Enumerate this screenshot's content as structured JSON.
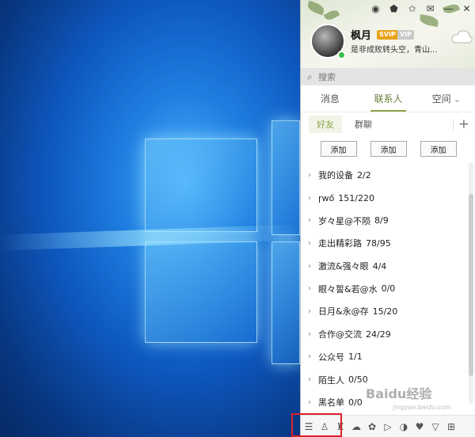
{
  "panel": {
    "profile": {
      "nickname": "枫月",
      "svip_badge": "SVIP",
      "vip_badge": "VIP",
      "signature": "是非成败转头空，青山...",
      "status_color": "#37c24a"
    },
    "search": {
      "placeholder": "搜索"
    },
    "main_tabs": [
      {
        "label": "消息",
        "active": false
      },
      {
        "label": "联系人",
        "active": true
      },
      {
        "label": "空间",
        "active": false,
        "dropdown_glyph": "⌄"
      }
    ],
    "sub_tabs": [
      {
        "label": "好友",
        "active": true
      },
      {
        "label": "群聊",
        "active": false
      }
    ],
    "add_plus_glyph": "+",
    "add_buttons": [
      "添加",
      "添加",
      "添加"
    ],
    "groups": [
      {
        "name": "我的设备",
        "count": "2/2"
      },
      {
        "name": "ɼwő",
        "count": "151/220"
      },
      {
        "name": "岁々星@不陨",
        "count": "8/9"
      },
      {
        "name": "走出精彩路",
        "count": "78/95"
      },
      {
        "name": "激流&强々眼",
        "count": "4/4"
      },
      {
        "name": "眼々誓&若@水",
        "count": "0/0"
      },
      {
        "name": "日月&永@存",
        "count": "15/20"
      },
      {
        "name": "合作@交流",
        "count": "24/29"
      },
      {
        "name": "公众号",
        "count": "1/1"
      },
      {
        "name": "陌生人",
        "count": "0/50"
      },
      {
        "name": "黑名单",
        "count": "0/0"
      }
    ],
    "chevron_glyph": "›",
    "title_icons": [
      "skin-icon",
      "shirt-icon",
      "star-icon",
      "mail-icon",
      "minimize-icon",
      "close-icon"
    ],
    "title_glyphs": [
      "◉",
      "⬟",
      "✩",
      "✉",
      "—",
      "✕"
    ],
    "bottom_icons": [
      "menu-icon",
      "add-friend-icon",
      "app-1-icon",
      "app-2-icon",
      "app-3-icon",
      "app-4-icon",
      "app-5-icon",
      "app-6-icon",
      "app-7-icon",
      "grid-icon"
    ],
    "bottom_glyphs": [
      "☰",
      "♙",
      "♜",
      "☁",
      "✿",
      "▷",
      "◑",
      "♥",
      "▽",
      "⊞"
    ],
    "accent_color": "#8aa34a",
    "highlight_color": "#e0202a"
  },
  "watermark": {
    "text": "Baidu经验",
    "sub": "jingyan.baidu.com"
  }
}
